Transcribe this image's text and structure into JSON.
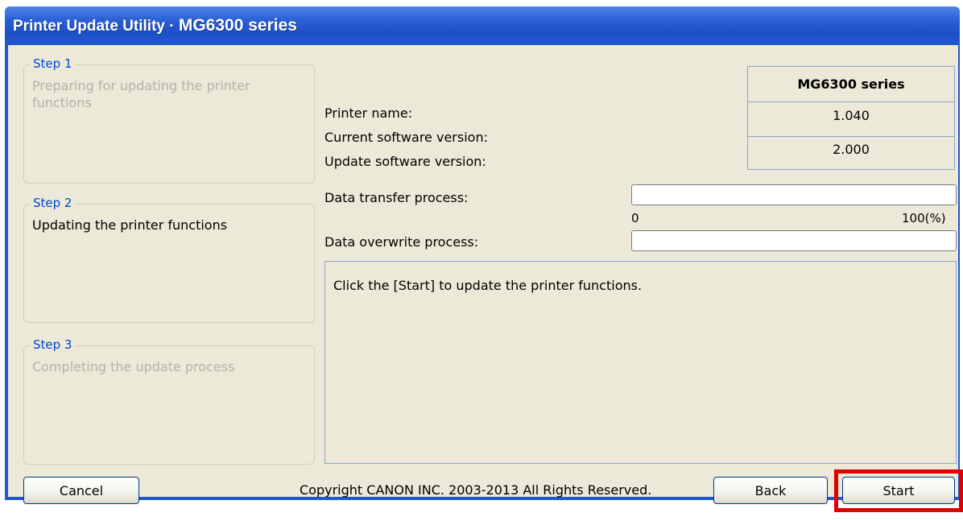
{
  "window": {
    "title_prefix": "Printer Update Utility · ",
    "title_model": "MG6300 series"
  },
  "steps": [
    {
      "label": "Step 1",
      "description": "Preparing for updating the printer functions",
      "state": "inactive"
    },
    {
      "label": "Step 2",
      "description": "Updating the printer functions",
      "state": "active"
    },
    {
      "label": "Step 3",
      "description": "Completing the update process",
      "state": "inactive"
    }
  ],
  "info": {
    "printer_name_label": "Printer name:",
    "printer_name_value": "MG6300 series",
    "current_version_label": "Current software version:",
    "current_version_value": "1.040",
    "update_version_label": "Update software version:",
    "update_version_value": "2.000"
  },
  "progress": {
    "transfer_label": "Data transfer process:",
    "transfer_percent": 0,
    "scale_min": "0",
    "scale_max": "100(%)",
    "overwrite_label": "Data overwrite process:",
    "overwrite_percent": 0
  },
  "message": "Click the [Start] to update the printer functions.",
  "footer": {
    "cancel_label": "Cancel",
    "copyright": "Copyright CANON INC. 2003-2013 All Rights Reserved.",
    "back_label": "Back",
    "start_label": "Start"
  },
  "colors": {
    "highlight": "#e00000",
    "step_label": "#0046d5",
    "step_inactive": "#b4b2a6"
  }
}
